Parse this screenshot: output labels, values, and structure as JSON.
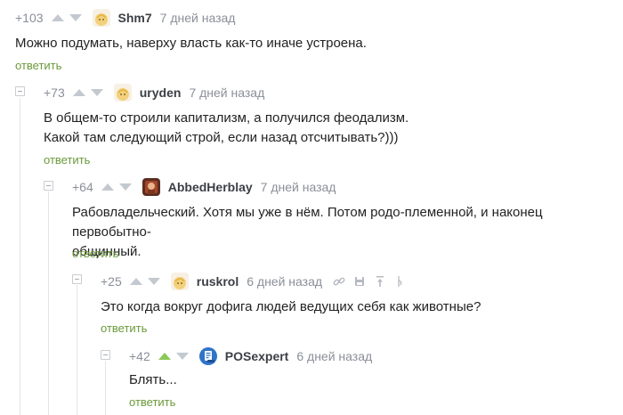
{
  "comments": [
    {
      "rating": "+103",
      "user": "Shm7",
      "date": "7 дней назад",
      "lines": [
        "Можно подумать, наверху власть как-то иначе устроена."
      ],
      "reply": "ответить"
    },
    {
      "rating": "+73",
      "user": "uryden",
      "date": "7 дней назад",
      "lines": [
        "В общем-то строили капитализм, а получился феодализм.",
        "Какой там следующий строй, если назад отсчитывать?)))"
      ],
      "reply": "ответить"
    },
    {
      "rating": "+64",
      "user": "AbbedHerblay",
      "date": "7 дней назад",
      "lines": [
        "Рабовладельческий. Хотя мы уже в нём. Потом родо-племенной, и наконец первобытно-",
        "общинный."
      ],
      "reply": "ответить"
    },
    {
      "rating": "+25",
      "user": "ruskrol",
      "date": "6 дней назад",
      "lines": [
        "Это когда вокруг дофига людей ведущих себя как животные?"
      ],
      "reply": "ответить"
    },
    {
      "rating": "+42",
      "user": "POSexpert",
      "date": "6 дней назад",
      "lines": [
        "Блять..."
      ],
      "reply": "ответить"
    }
  ],
  "icons": {
    "link": "link-icon",
    "save": "save-icon",
    "pin": "pin-top-icon",
    "dna": "dna-icon"
  },
  "colors": {
    "reply": "#6b9a3a",
    "vote_up_active": "#8ac858",
    "vote_inactive": "#c4c9d0"
  }
}
